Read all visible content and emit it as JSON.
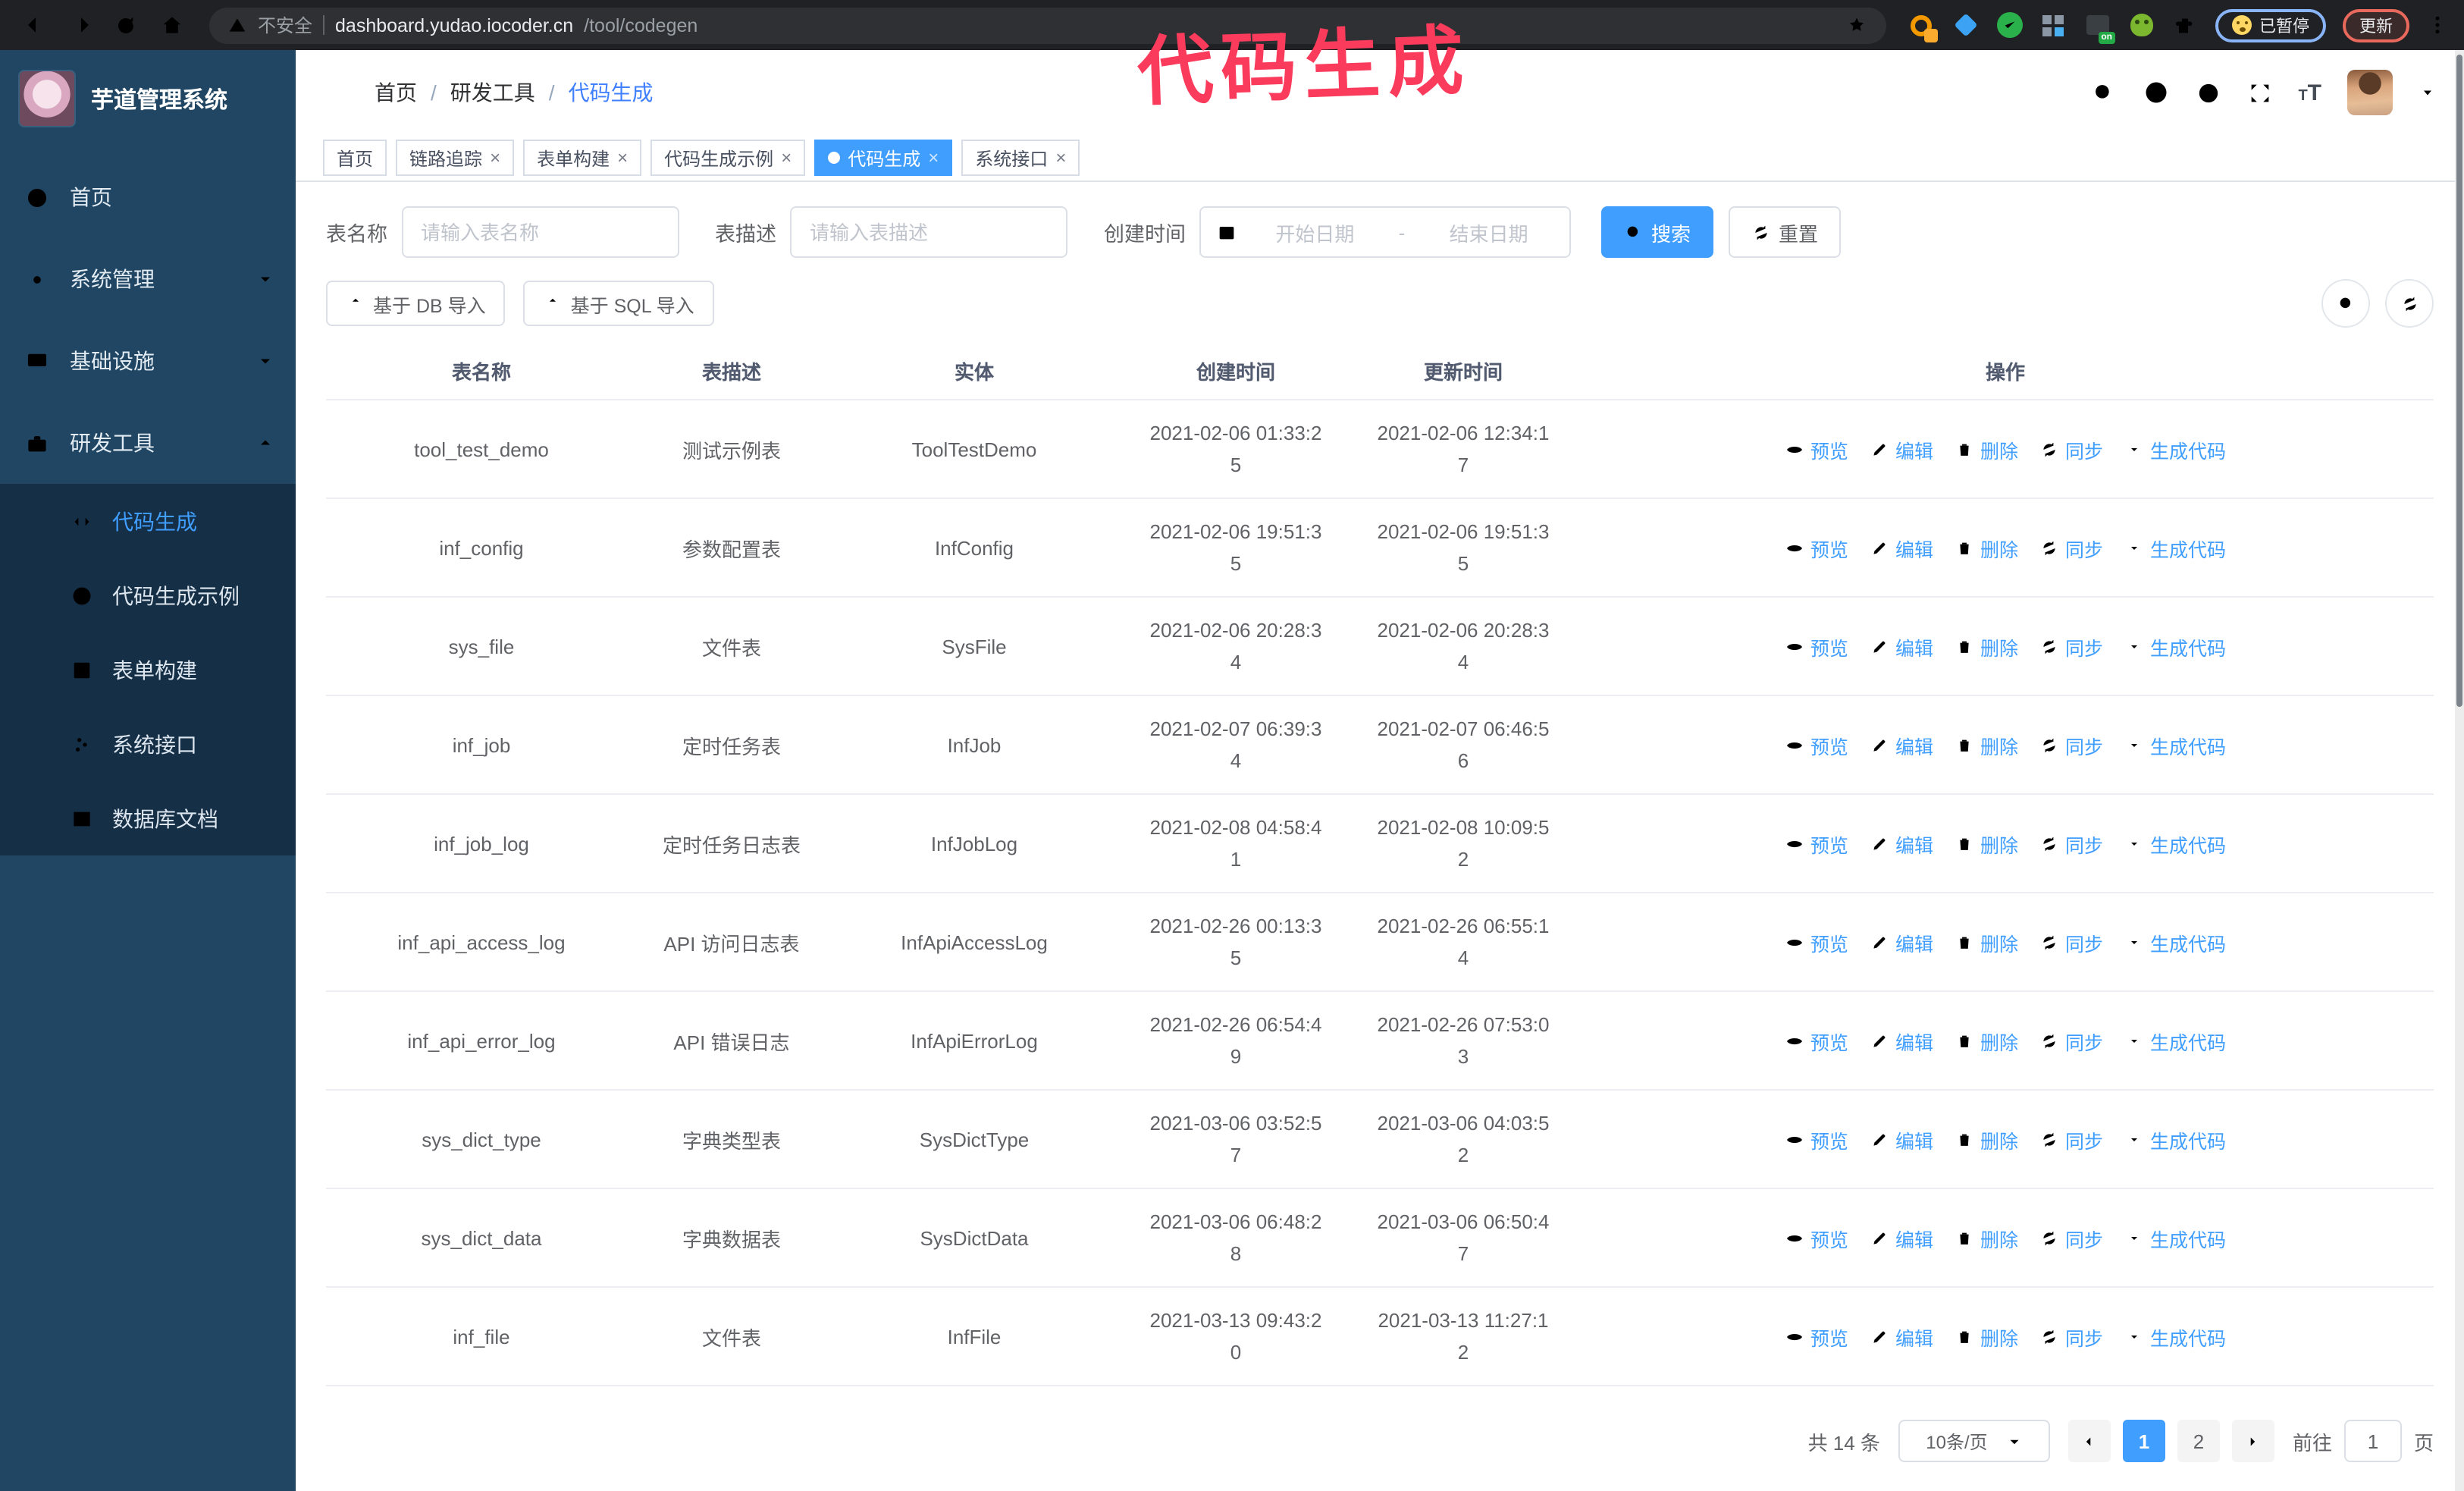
{
  "browser": {
    "security_label": "不安全",
    "url_host": "dashboard.yudao.iocoder.cn",
    "url_path": "/tool/codegen",
    "extensions": {
      "on_badge": "on",
      "paused_label": "已暂停",
      "update_label": "更新"
    }
  },
  "annotation": {
    "text": "代码生成",
    "color": "#fb3b5c"
  },
  "sidebar": {
    "logo_title": "芋道管理系统",
    "menu": [
      {
        "label": "首页"
      },
      {
        "label": "系统管理"
      },
      {
        "label": "基础设施"
      },
      {
        "label": "研发工具"
      }
    ],
    "submenu": [
      {
        "label": "代码生成",
        "active": true
      },
      {
        "label": "代码生成示例"
      },
      {
        "label": "表单构建"
      },
      {
        "label": "系统接口"
      },
      {
        "label": "数据库文档"
      }
    ]
  },
  "navbar": {
    "breadcrumb": [
      "首页",
      "研发工具",
      "代码生成"
    ]
  },
  "tags": [
    {
      "label": "首页"
    },
    {
      "label": "链路追踪"
    },
    {
      "label": "表单构建"
    },
    {
      "label": "代码生成示例"
    },
    {
      "label": "代码生成",
      "active": true
    },
    {
      "label": "系统接口"
    }
  ],
  "filters": {
    "name_label": "表名称",
    "name_placeholder": "请输入表名称",
    "desc_label": "表描述",
    "desc_placeholder": "请输入表描述",
    "time_label": "创建时间",
    "start_placeholder": "开始日期",
    "range_separator": "-",
    "end_placeholder": "结束日期",
    "search_label": "搜索",
    "reset_label": "重置"
  },
  "toolbar": {
    "import_db_label": "基于 DB 导入",
    "import_sql_label": "基于 SQL 导入"
  },
  "table": {
    "columns": [
      "表名称",
      "表描述",
      "实体",
      "创建时间",
      "更新时间",
      "操作"
    ],
    "actions": [
      "预览",
      "编辑",
      "删除",
      "同步",
      "生成代码"
    ],
    "rows": [
      {
        "name": "tool_test_demo",
        "desc": "测试示例表",
        "entity": "ToolTestDemo",
        "created": "2021-02-06 01:33:25",
        "updated": "2021-02-06 12:34:17"
      },
      {
        "name": "inf_config",
        "desc": "参数配置表",
        "entity": "InfConfig",
        "created": "2021-02-06 19:51:35",
        "updated": "2021-02-06 19:51:35"
      },
      {
        "name": "sys_file",
        "desc": "文件表",
        "entity": "SysFile",
        "created": "2021-02-06 20:28:34",
        "updated": "2021-02-06 20:28:34"
      },
      {
        "name": "inf_job",
        "desc": "定时任务表",
        "entity": "InfJob",
        "created": "2021-02-07 06:39:34",
        "updated": "2021-02-07 06:46:56"
      },
      {
        "name": "inf_job_log",
        "desc": "定时任务日志表",
        "entity": "InfJobLog",
        "created": "2021-02-08 04:58:41",
        "updated": "2021-02-08 10:09:52"
      },
      {
        "name": "inf_api_access_log",
        "desc": "API 访问日志表",
        "entity": "InfApiAccessLog",
        "created": "2021-02-26 00:13:35",
        "updated": "2021-02-26 06:55:14"
      },
      {
        "name": "inf_api_error_log",
        "desc": "API 错误日志",
        "entity": "InfApiErrorLog",
        "created": "2021-02-26 06:54:49",
        "updated": "2021-02-26 07:53:03"
      },
      {
        "name": "sys_dict_type",
        "desc": "字典类型表",
        "entity": "SysDictType",
        "created": "2021-03-06 03:52:57",
        "updated": "2021-03-06 04:03:52"
      },
      {
        "name": "sys_dict_data",
        "desc": "字典数据表",
        "entity": "SysDictData",
        "created": "2021-03-06 06:48:28",
        "updated": "2021-03-06 06:50:47"
      },
      {
        "name": "inf_file",
        "desc": "文件表",
        "entity": "InfFile",
        "created": "2021-03-13 09:43:20",
        "updated": "2021-03-13 11:27:12"
      }
    ]
  },
  "pagination": {
    "total_label": "共 14 条",
    "page_size_label": "10条/页",
    "pages": [
      "1",
      "2"
    ],
    "active_page": "1",
    "goto_label": "前往",
    "goto_value": "1",
    "page_unit_label": "页"
  },
  "icons": {
    "actions": [
      "eye",
      "pencil",
      "trash",
      "sync",
      "download"
    ],
    "navbar": [
      "search",
      "github",
      "question-circle",
      "fullscreen",
      "font-size",
      "avatar",
      "caret-down"
    ],
    "browser": [
      "back-arrow",
      "forward-arrow",
      "reload",
      "home",
      "warning-triangle",
      "star",
      "puzzle",
      "more-vertical"
    ]
  },
  "colors": {
    "primary": "#409eff",
    "sidebar_bg": "#204663",
    "submenu_bg": "#152f47",
    "tag_active": "#409eff",
    "annotation": "#fb3b5c",
    "browser_bar": "#202124",
    "update_badge_border": "#e9695c",
    "paused_badge_border": "#8ab4f8"
  }
}
